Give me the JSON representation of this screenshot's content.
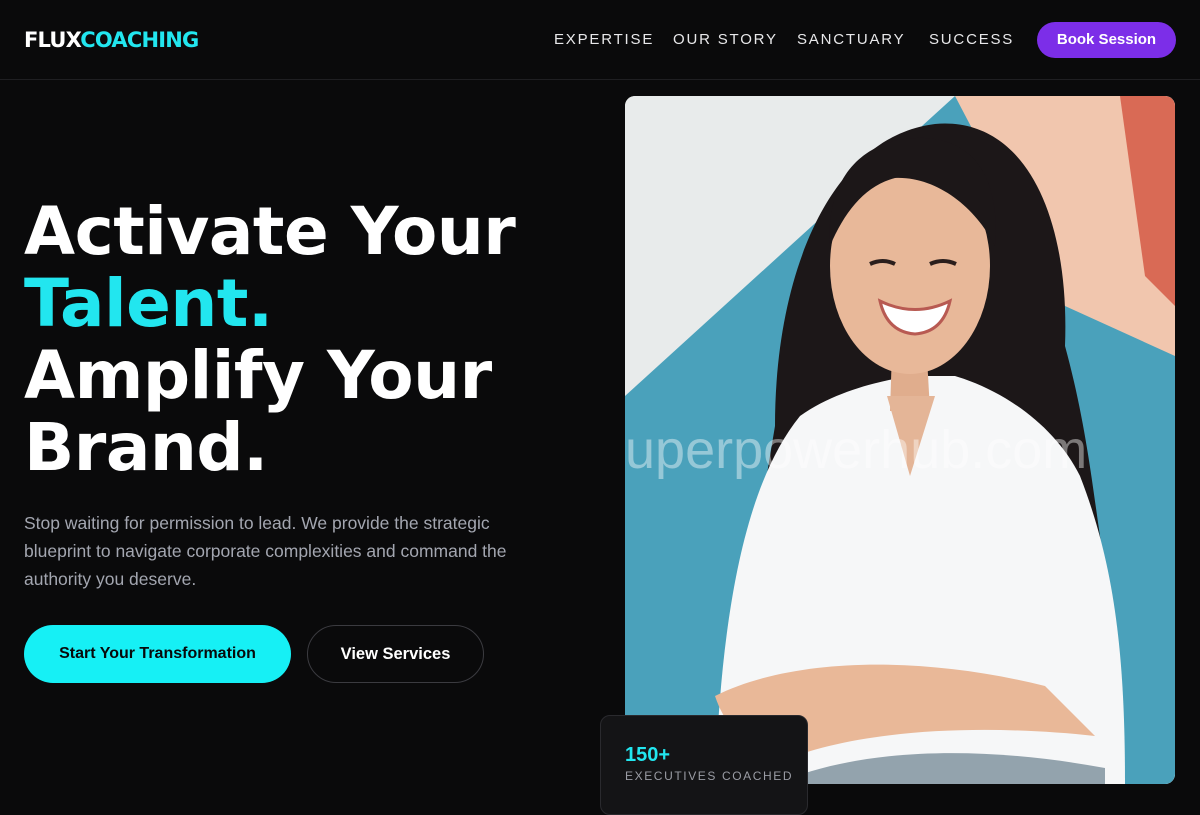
{
  "brand": {
    "part1": "FLUX",
    "part2": "COACHING"
  },
  "nav": {
    "items": [
      "EXPERTISE",
      "OUR STORY",
      "SANCTUARY",
      "SUCCESS"
    ],
    "cta": "Book Session"
  },
  "hero": {
    "line1": "Activate Your",
    "line2": "Talent.",
    "line3": "Amplify Your",
    "line4": "Brand.",
    "description": "Stop waiting for permission to lead. We provide the strategic blueprint to navigate corporate complexities and command the authority you deserve.",
    "primary_cta": "Start Your Transformation",
    "secondary_cta": "View Services"
  },
  "photo": {
    "watermark": "uperpowerhub.com"
  },
  "stat": {
    "value": "150+",
    "label": "EXECUTIVES COACHED"
  },
  "colors": {
    "background": "#0a0a0b",
    "accent_cyan": "#22e6ef",
    "accent_purple": "#7c2ee8",
    "muted_text": "#a3a6b0"
  }
}
